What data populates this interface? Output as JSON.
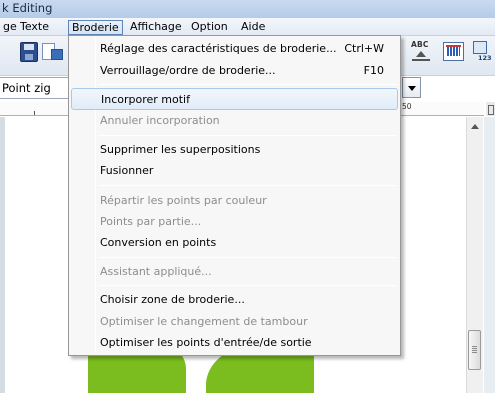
{
  "window": {
    "title_fragment": "k Editing"
  },
  "menubar": {
    "items": [
      {
        "label": "ge",
        "open": false
      },
      {
        "label": "Texte",
        "open": false
      },
      {
        "label": "Broderie",
        "open": true
      },
      {
        "label": "Affichage",
        "open": false
      },
      {
        "label": "Option",
        "open": false
      },
      {
        "label": "Aide",
        "open": false
      }
    ]
  },
  "toolbar": {
    "icons": [
      "save-icon",
      "export-icon",
      "abc-text-icon",
      "thread-color-icon",
      "numbering-icon"
    ],
    "abc_text": "ABC",
    "numbering_text": "123"
  },
  "combo": {
    "stitch_type": "Point zig"
  },
  "ruler": {
    "label": "50"
  },
  "broderie_menu": {
    "items": [
      {
        "label": "Réglage des caractéristiques de broderie...",
        "shortcut": "Ctrl+W",
        "enabled": true
      },
      {
        "label": "Verrouillage/ordre de broderie...",
        "shortcut": "F10",
        "enabled": true
      },
      {
        "separator": true
      },
      {
        "label": "Incorporer motif",
        "shortcut": "",
        "enabled": true,
        "highlighted": true
      },
      {
        "label": "Annuler incorporation",
        "shortcut": "",
        "enabled": false
      },
      {
        "separator": true
      },
      {
        "label": "Supprimer les superpositions",
        "shortcut": "",
        "enabled": true
      },
      {
        "label": "Fusionner",
        "shortcut": "",
        "enabled": true
      },
      {
        "separator": true
      },
      {
        "label": "Répartir les points par couleur",
        "shortcut": "",
        "enabled": false
      },
      {
        "label": "Points par partie...",
        "shortcut": "",
        "enabled": false
      },
      {
        "label": "Conversion en points",
        "shortcut": "",
        "enabled": true
      },
      {
        "separator": true
      },
      {
        "label": "Assistant appliqué...",
        "shortcut": "",
        "enabled": false
      },
      {
        "separator": true
      },
      {
        "label": "Choisir zone de broderie...",
        "shortcut": "",
        "enabled": true
      },
      {
        "label": "Optimiser le changement de tambour",
        "shortcut": "",
        "enabled": false
      },
      {
        "label": "Optimiser les points d'entrée/de sortie",
        "shortcut": "",
        "enabled": true
      }
    ]
  },
  "colors": {
    "motif_green": "#7bbd1f",
    "menu_highlight_border": "#a8c8ec",
    "disabled_text": "#8d8d8d"
  }
}
